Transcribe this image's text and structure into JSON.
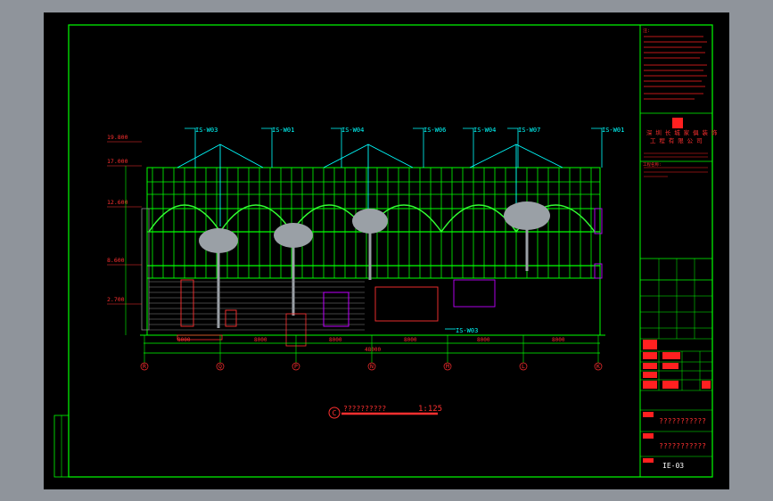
{
  "sheet": {
    "title_text": "??????????",
    "scale_label": "1:125",
    "section_marker": "C"
  },
  "tags": {
    "t1": "IS-W03",
    "t2": "IS-W01",
    "t3": "IS-W04",
    "t4": "IS-W06",
    "t5": "IS-W04",
    "t6": "IS-W07",
    "t7": "IS-W01",
    "t8": "IS-W03"
  },
  "elevations": [
    "19.800",
    "17.000",
    "12.600",
    "8.600",
    "2.700"
  ],
  "grid_axes": [
    "R",
    "Q",
    "P",
    "N",
    "M",
    "L",
    "K"
  ],
  "dimensions": [
    "8000",
    "8000",
    "8000",
    "8000",
    "8000",
    "8000",
    "48000"
  ],
  "title_block": {
    "notes_heading": "注:",
    "company_line1": "深 圳 长 城 家 俱 装 饰",
    "company_line2": "工 程 有 限 公 司",
    "project_heading": "工程名称:",
    "row1": "???????????",
    "row2": "???????????",
    "drawing_no": "IE-03"
  },
  "colors": {
    "frame": "#00ff00",
    "annotation": "#00ffff",
    "text_red": "#ff0000",
    "structure": "#00ff00",
    "glazing": "#c000ff"
  }
}
